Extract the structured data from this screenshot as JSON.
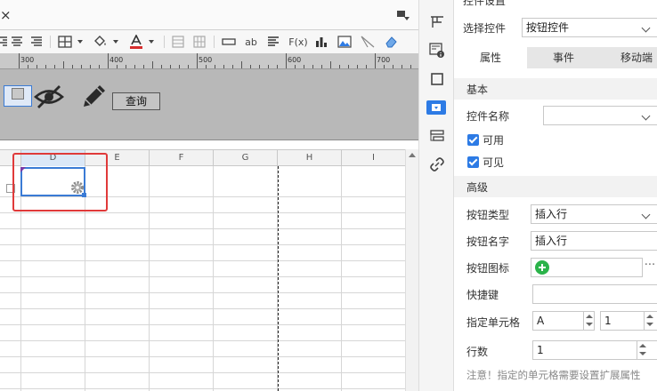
{
  "editor": {
    "tab_close": "×",
    "toolbar": {
      "text_label": "ab",
      "formula_label": "F(x)"
    },
    "ruler": [
      "300",
      "400",
      "500",
      "600",
      "700"
    ],
    "form": {
      "query_button": "查询"
    },
    "columns": [
      "D",
      "E",
      "F",
      "G",
      "H",
      "I"
    ]
  },
  "icon_column": {
    "icons": [
      "layout-icon",
      "form-info-icon",
      "frame-icon",
      "widget-icon",
      "list-icon",
      "link-icon"
    ],
    "active": "widget-icon"
  },
  "panel": {
    "title": "控件设置",
    "select_control_label": "选择控件",
    "select_control_value": "按钮控件",
    "tabs": [
      "属性",
      "事件",
      "移动端"
    ],
    "active_tab": "属性",
    "section_basic": "基本",
    "control_name_label": "控件名称",
    "control_name_value": "",
    "enabled_label": "可用",
    "visible_label": "可见",
    "section_advanced": "高级",
    "button_type_label": "按钮类型",
    "button_type_value": "插入行",
    "button_name_label": "按钮名字",
    "button_name_value": "插入行",
    "button_icon_label": "按钮图标",
    "more_label": "···",
    "shortcut_label": "快捷键",
    "shortcut_value": "",
    "target_cell_label": "指定单元格",
    "target_cell_col": "A",
    "target_cell_row": "1",
    "row_count_label": "行数",
    "row_count_value": "1",
    "note": "注意！指定的单元格需要设置扩展属性"
  },
  "colors": {
    "accent": "#2d7be5",
    "highlight": "#e03a3a",
    "plus": "#2bb34a"
  }
}
